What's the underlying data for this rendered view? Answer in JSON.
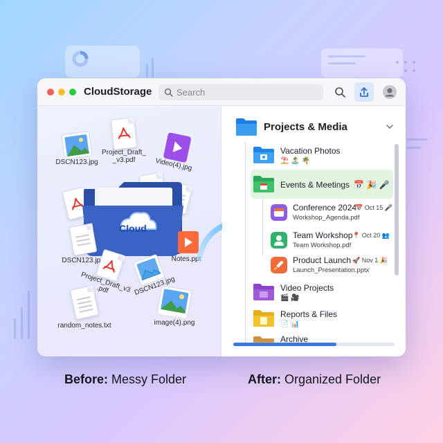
{
  "app": {
    "title": "CloudStorage"
  },
  "titlebar": {
    "traffic_lights": [
      "#f25f57",
      "#f8be2f",
      "#2ac840"
    ],
    "search_placeholder": "Search",
    "icons": [
      "magnifier-icon",
      "upload-icon",
      "user-avatar-icon"
    ]
  },
  "left_pane": {
    "cloud_label": "Cloud",
    "files": [
      {
        "name": "DSCN123.jpg",
        "icon": "image-file-icon"
      },
      {
        "name": "Project_Draft_\n_v3.pdf",
        "icon": "pdf-file-icon"
      },
      {
        "name": "Video(4).jpg",
        "icon": "video-file-icon"
      },
      {
        "name": "DSCN123.jpg",
        "icon": "document-file-icon"
      },
      {
        "name": "Project_Draft_v3\n.pdf",
        "icon": "pdf-file-icon"
      },
      {
        "name": "DSCN123.jpg",
        "icon": "image-file-icon"
      },
      {
        "name": "Notes.ppt",
        "icon": "ppt-file-icon"
      },
      {
        "name": "random_notes.txt",
        "icon": "text-file-icon"
      },
      {
        "name": "image(4).png",
        "icon": "image-file-icon"
      }
    ]
  },
  "right_pane": {
    "root": {
      "label": "Projects & Media",
      "chevron": "chevron-down-icon"
    },
    "items": [
      {
        "label": "Vacation Photos",
        "emoji": "⛱️ 🏝️ 🌴",
        "color": "#3b9cf0"
      },
      {
        "label": "Events & Meetings",
        "emoji": "📅 🎉 🎤",
        "color": "#3ec16a",
        "selected": true,
        "children": [
          {
            "label": "Conference 2024",
            "meta": "📅 Oct 15 🎤",
            "file": "Workshop_Agenda.pdf",
            "icon_color": "#8e5ce6"
          },
          {
            "label": "Team Workshop",
            "meta": "📍 Oct 20 👥",
            "file": "Team Workshop.pdf",
            "icon_color": "#2fb36a"
          },
          {
            "label": "Product Launch",
            "meta": "🚀 Nov 1 🎉",
            "file": "Launch_Presentation.pptx",
            "icon_color": "#f06a3a"
          }
        ]
      },
      {
        "label": "Video Projects",
        "emoji": "🎬 🎥",
        "color": "#a05ad8"
      },
      {
        "label": "Reports & Files",
        "emoji": "📄 📊",
        "color": "#f2c230"
      },
      {
        "label": "Archive",
        "emoji": "",
        "color": "#e0a850"
      }
    ],
    "progress": 0.64
  },
  "captions": {
    "before_bold": "Before:",
    "before_rest": " Messy Folder",
    "after_bold": "After:",
    "after_rest": " Organized Folder"
  }
}
